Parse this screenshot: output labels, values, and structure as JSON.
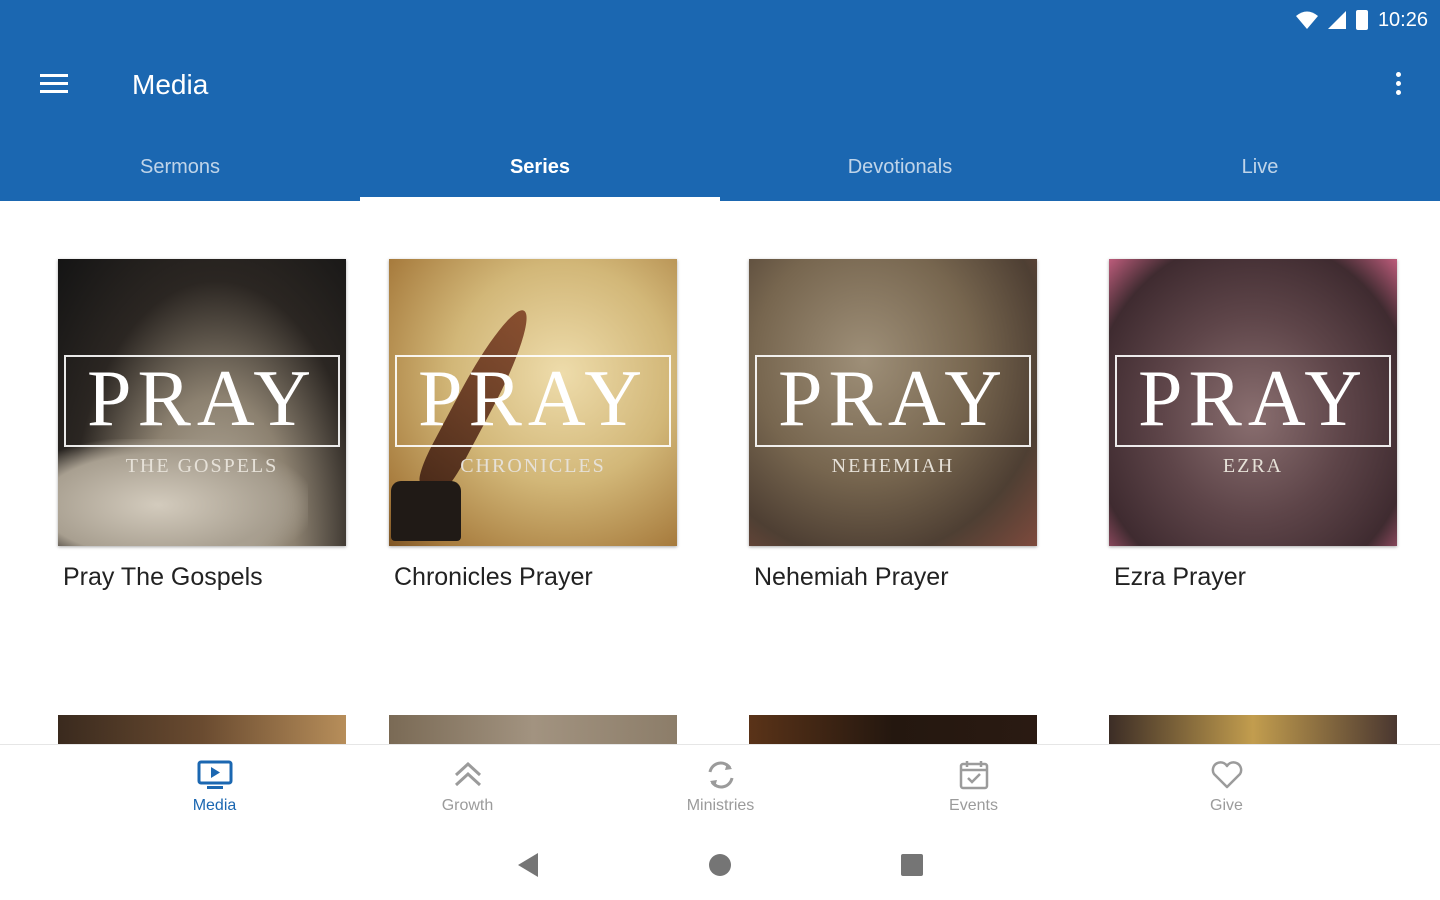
{
  "status_bar": {
    "time": "10:26"
  },
  "toolbar": {
    "title": "Media"
  },
  "tabs": [
    {
      "label": "Sermons"
    },
    {
      "label": "Series"
    },
    {
      "label": "Devotionals"
    },
    {
      "label": "Live"
    }
  ],
  "series": [
    {
      "title": "Pray The Gospels",
      "art_word": "PRAY",
      "art_subtitle": "THE GOSPELS"
    },
    {
      "title": "Chronicles Prayer",
      "art_word": "PRAY",
      "art_subtitle": "CHRONICLES"
    },
    {
      "title": "Nehemiah Prayer",
      "art_word": "PRAY",
      "art_subtitle": "NEHEMIAH"
    },
    {
      "title": "Ezra Prayer",
      "art_word": "PRAY",
      "art_subtitle": "EZRA"
    }
  ],
  "bottom_nav": [
    {
      "label": "Media",
      "icon": "tv-play-icon"
    },
    {
      "label": "Growth",
      "icon": "double-chevron-up-icon"
    },
    {
      "label": "Ministries",
      "icon": "refresh-cycle-icon"
    },
    {
      "label": "Events",
      "icon": "calendar-check-icon"
    },
    {
      "label": "Give",
      "icon": "heart-icon"
    }
  ],
  "colors": {
    "primary": "#1b67b1",
    "inactive": "#9b9b9b",
    "text": "#222222"
  }
}
